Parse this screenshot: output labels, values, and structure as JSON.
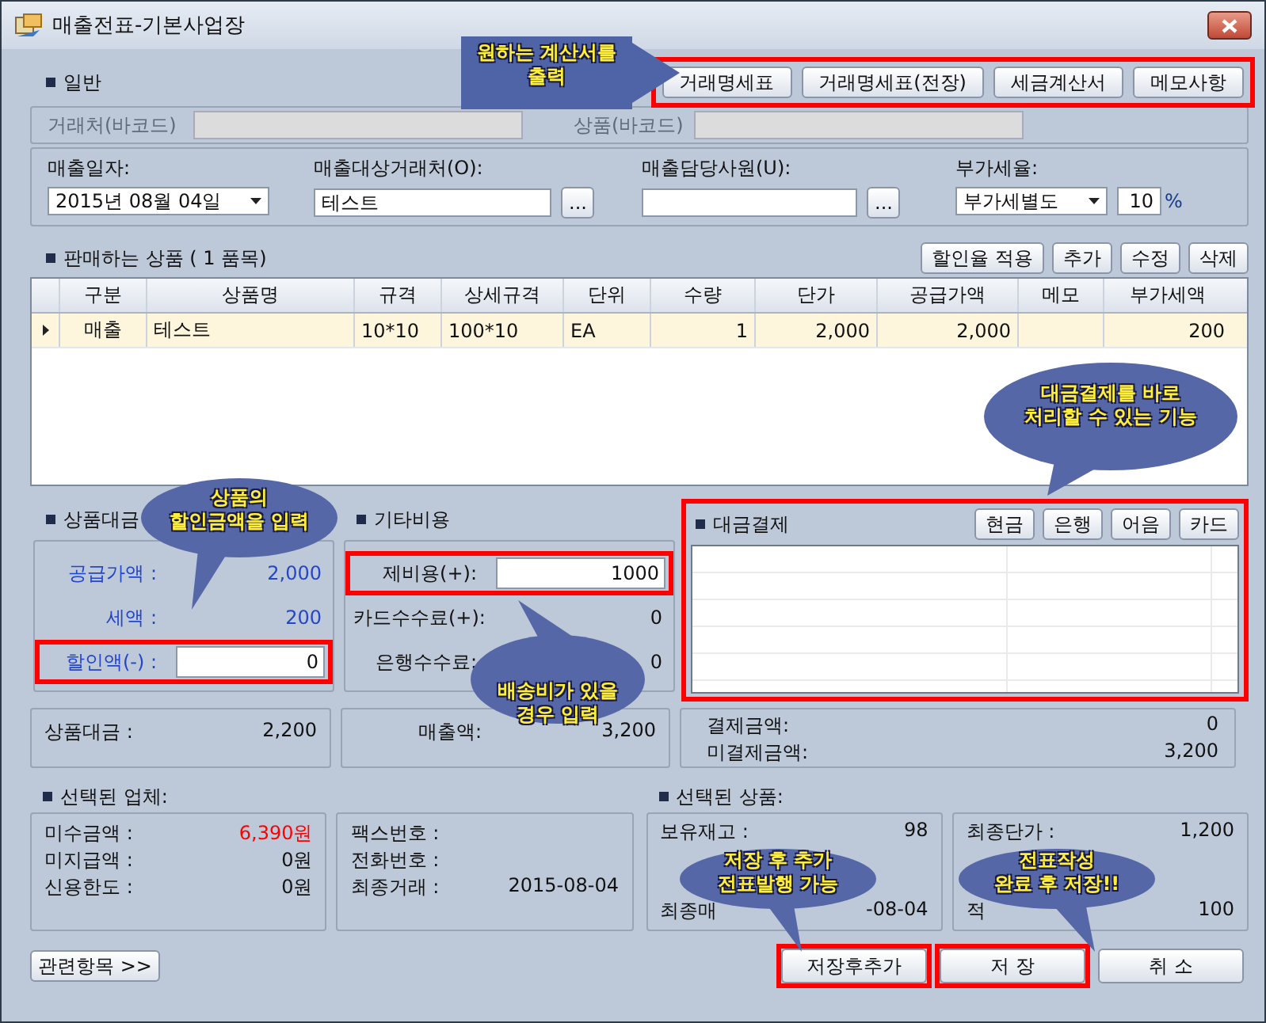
{
  "window": {
    "title": "매출전표-기본사업장"
  },
  "general": {
    "heading": "일반",
    "print_buttons": {
      "highlighted": true,
      "items": [
        "거래명세표",
        "거래명세표(전장)",
        "세금계산서",
        "메모사항"
      ]
    },
    "callout": {
      "kind": "arrow",
      "lines": [
        "원하는 계산서를",
        "출력"
      ]
    },
    "barcodes": [
      {
        "label": "거래처(바코드)",
        "disabled": true
      },
      {
        "label": "상품(바코드)",
        "disabled": true
      }
    ],
    "sale_date": {
      "label": "매출일자:",
      "value": "2015년 08월 04일"
    },
    "customer": {
      "label": "매출대상거래처(O):",
      "value": "테스트",
      "button": "..."
    },
    "staff": {
      "label": "매출담당사원(U):",
      "button": "..."
    },
    "vat": {
      "label": "부가세율:",
      "mode": "부가세별도",
      "rate": "10",
      "unit": "%"
    }
  },
  "products": {
    "heading": "판매하는 상품 ( 1 품목)",
    "buttons": [
      "할인율 적용",
      "추가",
      "수정",
      "삭제"
    ],
    "columns": [
      "구분",
      "상품명",
      "규격",
      "상세규격",
      "단위",
      "수량",
      "단가",
      "공급가액",
      "메모",
      "부가세액"
    ],
    "rows": [
      {
        "selected": true,
        "cells": [
          "매출",
          "테스트",
          "10*10",
          "100*10",
          "EA",
          "1",
          "2,000",
          "2,000",
          null,
          "200"
        ]
      }
    ],
    "callout": {
      "kind": "bubble",
      "lines": [
        "대금결제를 바로",
        "처리할 수 있는 기능"
      ]
    }
  },
  "goods_amount": {
    "heading": "상품대금",
    "callout": {
      "kind": "bubble",
      "lines": [
        "상품의",
        "할인금액을 입력"
      ]
    },
    "rows": [
      {
        "kind": "text",
        "label": "공급가액 :",
        "value": "2,000",
        "highlighted": false
      },
      {
        "kind": "text",
        "label": "세액 :",
        "value": "200",
        "highlighted": false
      },
      {
        "kind": "input",
        "label": "할인액(-) :",
        "value": "0",
        "highlighted": true
      }
    ],
    "total": {
      "label": "상품대금 :",
      "value": "2,200"
    }
  },
  "other_costs": {
    "heading": "기타비용",
    "callout": {
      "kind": "bubble",
      "lines": [
        "배송비가 있을",
        "경우 입력"
      ]
    },
    "rows": [
      {
        "kind": "input",
        "label": "제비용(+):",
        "value": "1000",
        "highlighted": true
      },
      {
        "kind": "text",
        "label": "카드수수료(+):",
        "value": "0",
        "highlighted": false
      },
      {
        "kind": "text",
        "label": "은행수수료:",
        "value": "0",
        "highlighted": false
      }
    ],
    "total": {
      "label": "매출액:",
      "value": "3,200"
    }
  },
  "payment": {
    "heading": "대금결제",
    "highlighted": true,
    "buttons": [
      "현금",
      "은행",
      "어음",
      "카드"
    ],
    "summary": [
      {
        "label": "결제금액:",
        "value": "0"
      },
      {
        "label": "미결제금액:",
        "value": "3,200"
      }
    ]
  },
  "selected_company": {
    "heading": "선택된 업체:",
    "left": [
      {
        "label": "미수금액 :",
        "value": "6,390원",
        "alert": true
      },
      {
        "label": "미지급액 :",
        "value": "0원",
        "alert": false
      },
      {
        "label": "신용한도 :",
        "value": "0원",
        "alert": false
      }
    ],
    "right": [
      {
        "label": "팩스번호 :"
      },
      {
        "label": "전화번호 :"
      },
      {
        "label": "최종거래 :",
        "value": "2015-08-04"
      }
    ]
  },
  "selected_product": {
    "heading": "선택된 상품:",
    "left": [
      {
        "label": "보유재고 :",
        "value": "98"
      },
      {
        "label": "최종매",
        "value": "-08-04"
      }
    ],
    "right": [
      {
        "label": "최종단가 :",
        "value": "1,200"
      },
      {
        "label": "적",
        "value": "100"
      }
    ]
  },
  "footer": {
    "related": "관련항목 >>",
    "buttons": [
      {
        "label": "저장후추가",
        "highlighted": true,
        "callout": {
          "kind": "bubble",
          "lines": [
            "저장 후 추가",
            "전표발행 가능"
          ]
        }
      },
      {
        "label": "저 장",
        "highlighted": true,
        "callout": {
          "kind": "bubble",
          "lines": [
            "전표작성",
            "완료 후 저장!!"
          ]
        }
      },
      {
        "label": "취 소",
        "highlighted": false
      }
    ]
  }
}
